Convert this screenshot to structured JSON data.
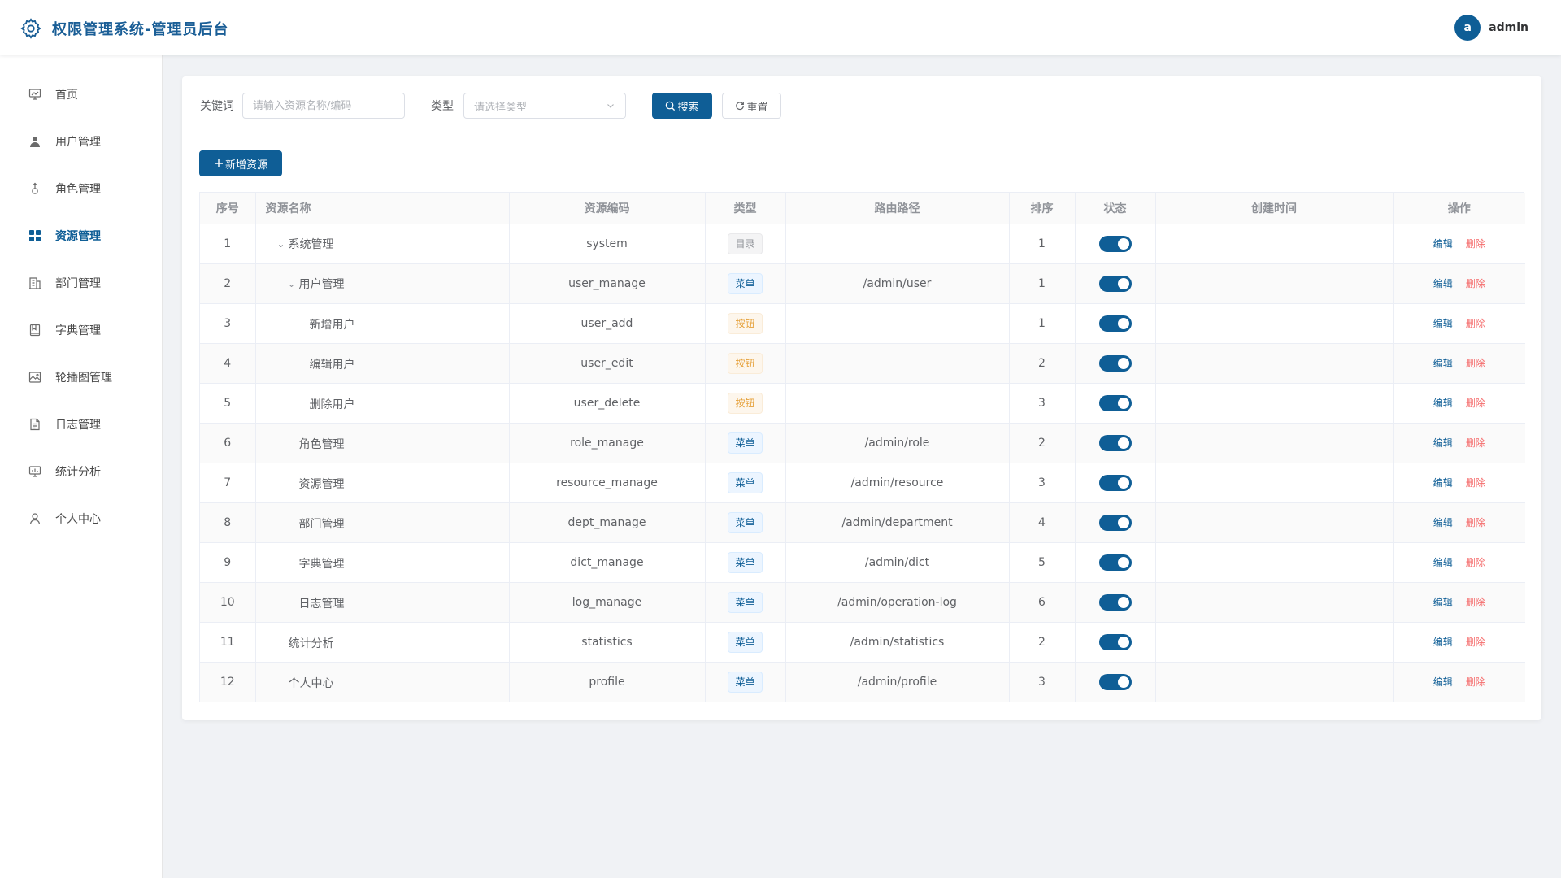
{
  "header": {
    "title": "权限管理系统-管理员后台",
    "avatar_letter": "a",
    "username": "admin"
  },
  "sidebar": {
    "items": [
      {
        "label": "首页",
        "icon": "dashboard-icon",
        "active": false
      },
      {
        "label": "用户管理",
        "icon": "user-icon",
        "active": false
      },
      {
        "label": "角色管理",
        "icon": "role-icon",
        "active": false
      },
      {
        "label": "资源管理",
        "icon": "grid-icon",
        "active": true
      },
      {
        "label": "部门管理",
        "icon": "building-icon",
        "active": false
      },
      {
        "label": "字典管理",
        "icon": "book-icon",
        "active": false
      },
      {
        "label": "轮播图管理",
        "icon": "picture-icon",
        "active": false
      },
      {
        "label": "日志管理",
        "icon": "document-icon",
        "active": false
      },
      {
        "label": "统计分析",
        "icon": "chart-icon",
        "active": false
      },
      {
        "label": "个人中心",
        "icon": "person-icon",
        "active": false
      }
    ]
  },
  "search": {
    "keyword_label": "关键词",
    "keyword_placeholder": "请输入资源名称/编码",
    "keyword_value": "",
    "type_label": "类型",
    "type_placeholder": "请选择类型",
    "search_button": "搜索",
    "reset_button": "重置"
  },
  "toolbar": {
    "add_button": "新增资源"
  },
  "table": {
    "columns": [
      "序号",
      "资源名称",
      "资源编码",
      "类型",
      "路由路径",
      "排序",
      "状态",
      "创建时间",
      "操作"
    ],
    "edit_label": "编辑",
    "delete_label": "删除",
    "rows": [
      {
        "no": "1",
        "name": "系统管理",
        "level": 0,
        "expanded": true,
        "code": "system",
        "type": "目录",
        "type_kind": "dir",
        "path": "",
        "sort": "1",
        "enabled": true,
        "created": ""
      },
      {
        "no": "2",
        "name": "用户管理",
        "level": 1,
        "expanded": true,
        "code": "user_manage",
        "type": "菜单",
        "type_kind": "menu",
        "path": "/admin/user",
        "sort": "1",
        "enabled": true,
        "created": ""
      },
      {
        "no": "3",
        "name": "新增用户",
        "level": 2,
        "expanded": null,
        "code": "user_add",
        "type": "按钮",
        "type_kind": "btn",
        "path": "",
        "sort": "1",
        "enabled": true,
        "created": ""
      },
      {
        "no": "4",
        "name": "编辑用户",
        "level": 2,
        "expanded": null,
        "code": "user_edit",
        "type": "按钮",
        "type_kind": "btn",
        "path": "",
        "sort": "2",
        "enabled": true,
        "created": ""
      },
      {
        "no": "5",
        "name": "删除用户",
        "level": 2,
        "expanded": null,
        "code": "user_delete",
        "type": "按钮",
        "type_kind": "btn",
        "path": "",
        "sort": "3",
        "enabled": true,
        "created": ""
      },
      {
        "no": "6",
        "name": "角色管理",
        "level": 1,
        "expanded": null,
        "code": "role_manage",
        "type": "菜单",
        "type_kind": "menu",
        "path": "/admin/role",
        "sort": "2",
        "enabled": true,
        "created": ""
      },
      {
        "no": "7",
        "name": "资源管理",
        "level": 1,
        "expanded": null,
        "code": "resource_manage",
        "type": "菜单",
        "type_kind": "menu",
        "path": "/admin/resource",
        "sort": "3",
        "enabled": true,
        "created": ""
      },
      {
        "no": "8",
        "name": "部门管理",
        "level": 1,
        "expanded": null,
        "code": "dept_manage",
        "type": "菜单",
        "type_kind": "menu",
        "path": "/admin/department",
        "sort": "4",
        "enabled": true,
        "created": ""
      },
      {
        "no": "9",
        "name": "字典管理",
        "level": 1,
        "expanded": null,
        "code": "dict_manage",
        "type": "菜单",
        "type_kind": "menu",
        "path": "/admin/dict",
        "sort": "5",
        "enabled": true,
        "created": ""
      },
      {
        "no": "10",
        "name": "日志管理",
        "level": 1,
        "expanded": null,
        "code": "log_manage",
        "type": "菜单",
        "type_kind": "menu",
        "path": "/admin/operation-log",
        "sort": "6",
        "enabled": true,
        "created": ""
      },
      {
        "no": "11",
        "name": "统计分析",
        "level": 0,
        "expanded": null,
        "code": "statistics",
        "type": "菜单",
        "type_kind": "menu",
        "path": "/admin/statistics",
        "sort": "2",
        "enabled": true,
        "created": ""
      },
      {
        "no": "12",
        "name": "个人中心",
        "level": 0,
        "expanded": null,
        "code": "profile",
        "type": "菜单",
        "type_kind": "menu",
        "path": "/admin/profile",
        "sort": "3",
        "enabled": true,
        "created": ""
      }
    ]
  },
  "colors": {
    "primary": "#0f5e96",
    "danger": "#f56c6c",
    "warning": "#e6a23c",
    "background": "#f0f2f5"
  }
}
